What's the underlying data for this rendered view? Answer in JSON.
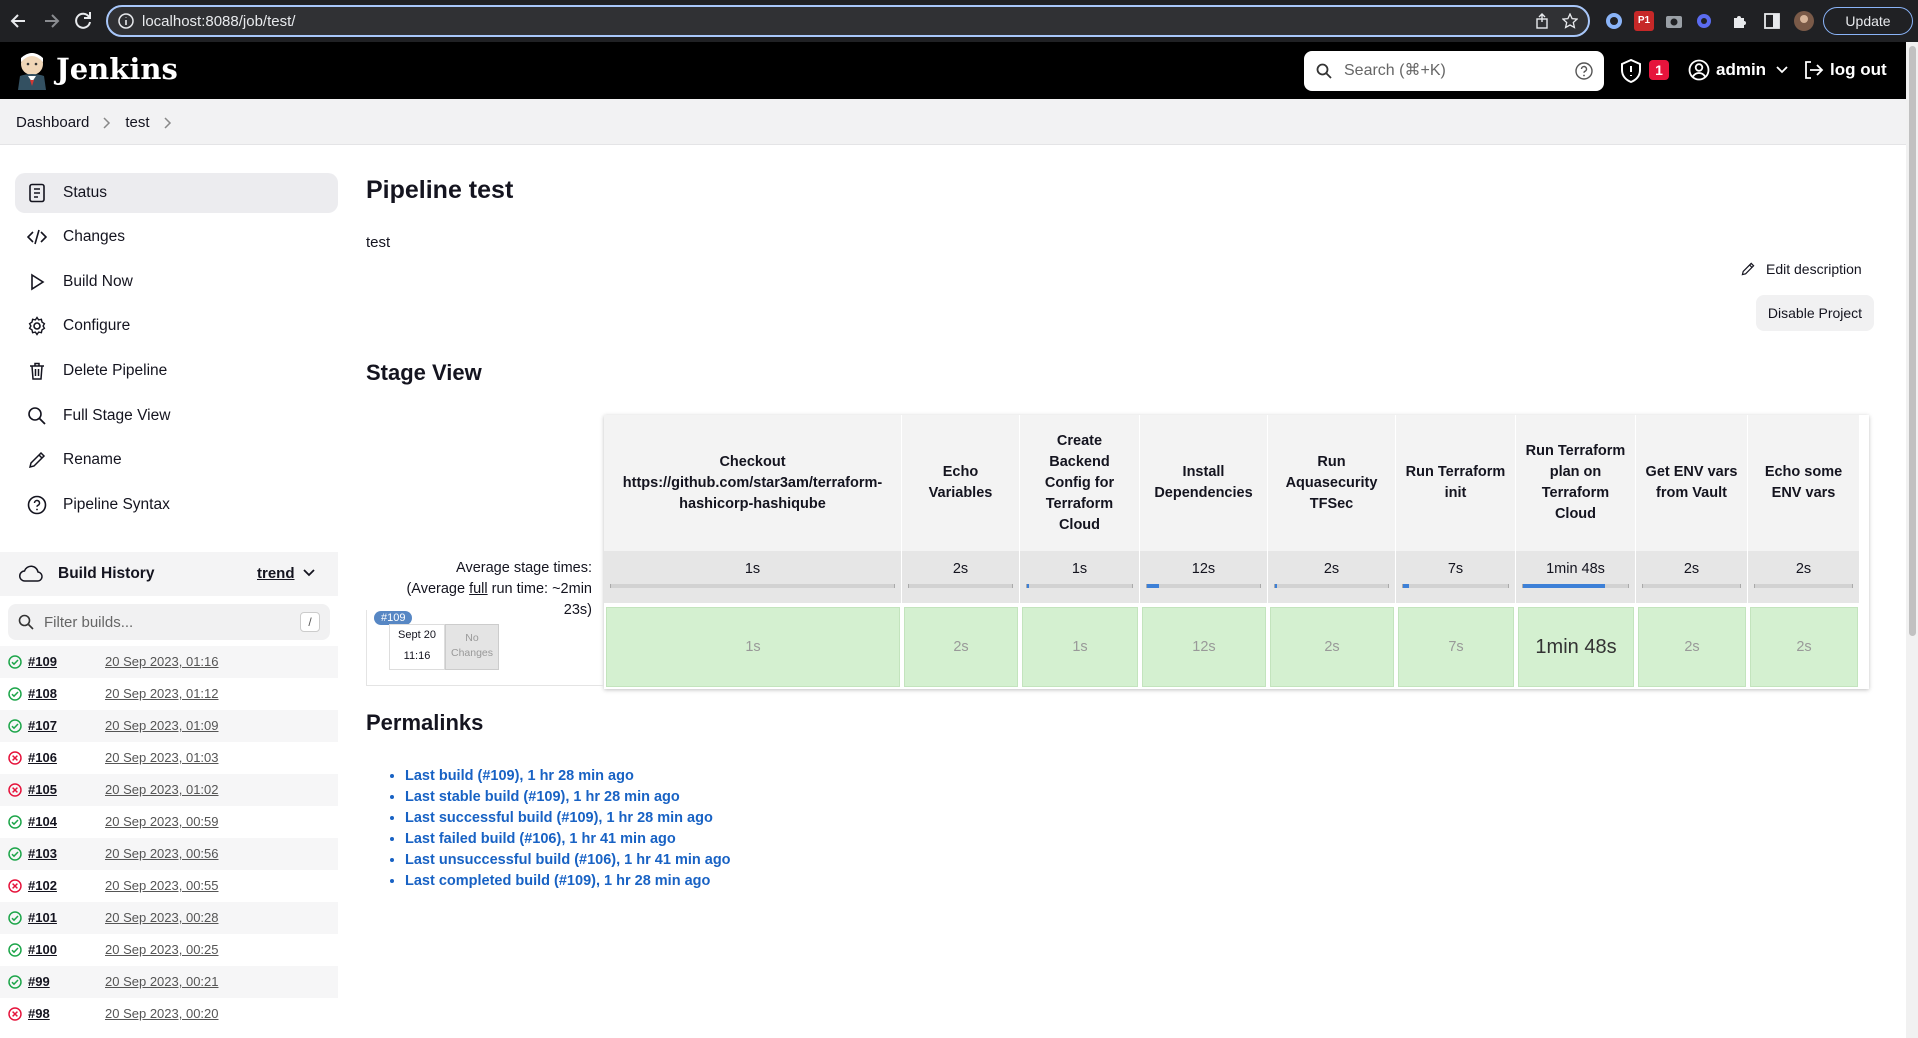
{
  "browser": {
    "url": "localhost:8088/job/test/",
    "update_label": "Update",
    "ext_badge": "P1"
  },
  "header": {
    "brand": "Jenkins",
    "search_placeholder": "Search (⌘+K)",
    "security_count": "1",
    "user": "admin",
    "logout": "log out"
  },
  "breadcrumb": [
    "Dashboard",
    "test"
  ],
  "sidebar": {
    "items": [
      {
        "label": "Status",
        "icon": "status-icon"
      },
      {
        "label": "Changes",
        "icon": "code-icon"
      },
      {
        "label": "Build Now",
        "icon": "play-icon"
      },
      {
        "label": "Configure",
        "icon": "gear-icon"
      },
      {
        "label": "Delete Pipeline",
        "icon": "trash-icon"
      },
      {
        "label": "Full Stage View",
        "icon": "search-icon"
      },
      {
        "label": "Rename",
        "icon": "pencil-icon"
      },
      {
        "label": "Pipeline Syntax",
        "icon": "help-icon"
      }
    ],
    "build_history": {
      "title": "Build History",
      "trend": "trend",
      "filter_placeholder": "Filter builds...",
      "filter_key": "/",
      "builds": [
        {
          "num": "#109",
          "date": "20 Sep 2023, 01:16",
          "status": "success"
        },
        {
          "num": "#108",
          "date": "20 Sep 2023, 01:12",
          "status": "success"
        },
        {
          "num": "#107",
          "date": "20 Sep 2023, 01:09",
          "status": "success"
        },
        {
          "num": "#106",
          "date": "20 Sep 2023, 01:03",
          "status": "failed"
        },
        {
          "num": "#105",
          "date": "20 Sep 2023, 01:02",
          "status": "failed"
        },
        {
          "num": "#104",
          "date": "20 Sep 2023, 00:59",
          "status": "success"
        },
        {
          "num": "#103",
          "date": "20 Sep 2023, 00:56",
          "status": "success"
        },
        {
          "num": "#102",
          "date": "20 Sep 2023, 00:55",
          "status": "failed"
        },
        {
          "num": "#101",
          "date": "20 Sep 2023, 00:28",
          "status": "success"
        },
        {
          "num": "#100",
          "date": "20 Sep 2023, 00:25",
          "status": "success"
        },
        {
          "num": "#99",
          "date": "20 Sep 2023, 00:21",
          "status": "success"
        },
        {
          "num": "#98",
          "date": "20 Sep 2023, 00:20",
          "status": "failed"
        }
      ]
    }
  },
  "main": {
    "title": "Pipeline test",
    "description": "test",
    "edit_description": "Edit description",
    "disable_project": "Disable Project",
    "stage_view_title": "Stage View",
    "avg_label_1": "Average stage times:",
    "avg_label_2a": "(Average ",
    "avg_label_2b": "full",
    "avg_label_2c": " run time: ~2min",
    "avg_label_3": "23s)",
    "run": {
      "tag": "#109",
      "date": "Sept 20",
      "time": "11:16",
      "changes_1": "No",
      "changes_2": "Changes"
    },
    "stages": [
      {
        "name": "Checkout https://github.com/star3am/terraform-hashicorp-hashiqube",
        "avg": "1s",
        "cell": "1s",
        "fill_fraction": 0.0
      },
      {
        "name": "Echo Variables",
        "avg": "2s",
        "cell": "2s",
        "fill_fraction": 0.0
      },
      {
        "name": "Create Backend Config for Terraform Cloud",
        "avg": "1s",
        "cell": "1s",
        "fill_fraction": 0.02
      },
      {
        "name": "Install Dependencies",
        "avg": "12s",
        "cell": "12s",
        "fill_fraction": 0.11
      },
      {
        "name": "Run Aquasecurity TFSec",
        "avg": "2s",
        "cell": "2s",
        "fill_fraction": 0.02
      },
      {
        "name": "Run Terraform init",
        "avg": "7s",
        "cell": "7s",
        "fill_fraction": 0.06
      },
      {
        "name": "Run Terraform plan on Terraform Cloud",
        "avg": "1min 48s",
        "cell": "1min 48s",
        "fill_fraction": 0.78
      },
      {
        "name": "Get ENV vars from Vault",
        "avg": "2s",
        "cell": "2s",
        "fill_fraction": 0.0
      },
      {
        "name": "Echo some ENV vars",
        "avg": "2s",
        "cell": "2s",
        "fill_fraction": 0.0
      }
    ],
    "permalinks_title": "Permalinks",
    "permalinks": [
      "Last build (#109), 1 hr 28 min ago",
      "Last stable build (#109), 1 hr 28 min ago",
      "Last successful build (#109), 1 hr 28 min ago",
      "Last failed build (#106), 1 hr 41 min ago",
      "Last unsuccessful build (#106), 1 hr 41 min ago",
      "Last completed build (#109), 1 hr 28 min ago"
    ]
  },
  "colors": {
    "success": "#1ea64b",
    "failed": "#e6143c",
    "stage_success": "#d4f0d0",
    "link": "#1862c4"
  }
}
